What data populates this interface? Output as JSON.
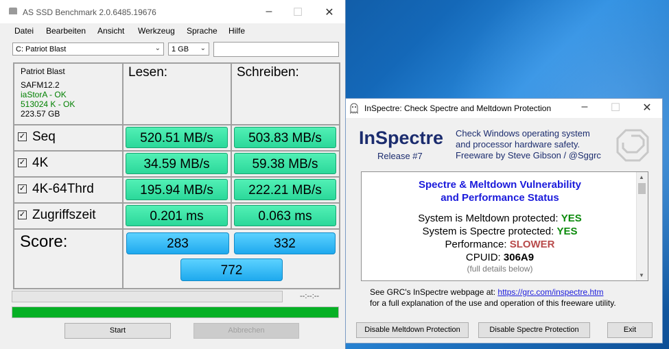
{
  "asssd": {
    "title": "AS SSD Benchmark 2.0.6485.19676",
    "menu": [
      "Datei",
      "Bearbeiten",
      "Ansicht",
      "Werkzeug",
      "Sprache",
      "Hilfe"
    ],
    "drive_select": "C: Patriot Blast",
    "size_select": "1 GB",
    "drive_info": {
      "model": "Patriot Blast",
      "firmware": "SAFM12.2",
      "driver": "iaStorA - OK",
      "alignment": "513024 K - OK",
      "capacity": "223.57 GB"
    },
    "col_read": "Lesen:",
    "col_write": "Schreiben:",
    "rows": [
      {
        "label": "Seq",
        "read": "520.51 MB/s",
        "write": "503.83 MB/s"
      },
      {
        "label": "4K",
        "read": "34.59 MB/s",
        "write": "59.38 MB/s"
      },
      {
        "label": "4K-64Thrd",
        "read": "195.94 MB/s",
        "write": "222.21 MB/s"
      },
      {
        "label": "Zugriffszeit",
        "read": "0.201 ms",
        "write": "0.063 ms"
      }
    ],
    "score_label": "Score:",
    "score_read": "283",
    "score_write": "332",
    "score_total": "772",
    "time": "--:--:--",
    "progress_top": 0,
    "progress_bottom": 1.0,
    "btn_start": "Start",
    "btn_abort": "Abbrechen",
    "colors": {
      "green": "#2bd89a",
      "blue": "#1ea9ee",
      "progress": "#06b025"
    }
  },
  "inspectre": {
    "title": "InSpectre: Check Spectre and Meltdown Protection",
    "logo": "InSpectre",
    "release": "Release #7",
    "blurb": [
      "Check Windows operating system",
      "and processor hardware safety.",
      "Freeware by Steve Gibson / @Sggrc"
    ],
    "panel_heading": [
      "Spectre & Meltdown Vulnerability",
      "and Performance Status"
    ],
    "meltdown_label": "System is Meltdown protected:",
    "meltdown_value": "YES",
    "spectre_label": "System is Spectre protected:",
    "spectre_value": "YES",
    "perf_label": "Performance:",
    "perf_value": "SLOWER",
    "cpuid_label": "CPUID:",
    "cpuid_value": "306A9",
    "details_note": "(full details below)",
    "see_text": "See GRC's InSpectre webpage at:",
    "url": "https://grc.com/inspectre.htm",
    "explain": "for a full explanation of the use and operation of this freeware utility.",
    "btn_meltdown": "Disable Meltdown Protection",
    "btn_spectre": "Disable Spectre Protection",
    "btn_exit": "Exit"
  }
}
